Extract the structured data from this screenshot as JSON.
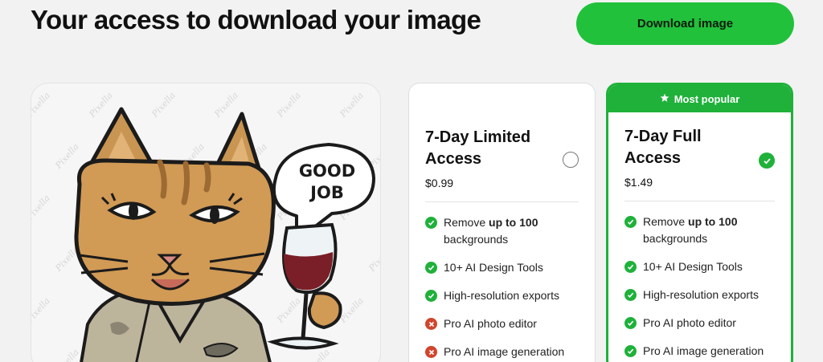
{
  "header": {
    "title": "Your access to download your image",
    "download_label": "Download image"
  },
  "preview": {
    "watermark_text": "Pixella",
    "speech_bubble": [
      "GOOD",
      "JOB"
    ]
  },
  "plans": [
    {
      "name": "7-Day Limited Access",
      "price": "$0.99",
      "selected": false,
      "features": [
        {
          "pre": "Remove ",
          "bold": "up to 100",
          "post": " backgrounds",
          "included": true
        },
        {
          "pre": "10+ AI Design Tools",
          "bold": "",
          "post": "",
          "included": true
        },
        {
          "pre": "High-resolution exports",
          "bold": "",
          "post": "",
          "included": true
        },
        {
          "pre": "Pro AI photo editor",
          "bold": "",
          "post": "",
          "included": false
        },
        {
          "pre": "Pro AI image generation",
          "bold": "",
          "post": "",
          "included": false
        }
      ]
    },
    {
      "badge": "Most popular",
      "name": "7-Day Full Access",
      "price": "$1.49",
      "selected": true,
      "features": [
        {
          "pre": "Remove ",
          "bold": "up to 100",
          "post": " backgrounds",
          "included": true
        },
        {
          "pre": "10+ AI Design Tools",
          "bold": "",
          "post": "",
          "included": true
        },
        {
          "pre": "High-resolution exports",
          "bold": "",
          "post": "",
          "included": true
        },
        {
          "pre": "Pro AI photo editor",
          "bold": "",
          "post": "",
          "included": true
        },
        {
          "pre": "Pro AI image generation",
          "bold": "",
          "post": "",
          "included": true
        }
      ]
    }
  ],
  "colors": {
    "accent": "#21c13c",
    "accent_dark": "#1fb13a",
    "excluded": "#d0452e",
    "background": "#f2f2f2"
  }
}
